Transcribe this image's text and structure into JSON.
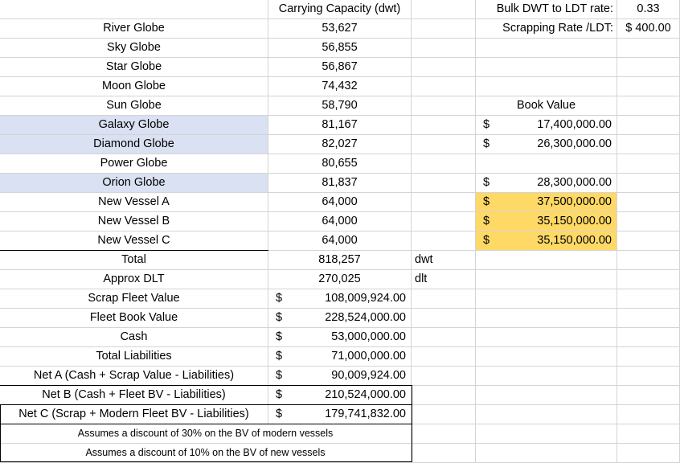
{
  "header": {
    "capacity_label": "Carrying Capacity (dwt)",
    "rate_label": "Bulk DWT to LDT rate:",
    "rate_value": "0.33",
    "scrap_label": "Scrapping Rate /LDT:",
    "scrap_value": "$ 400.00",
    "book_value_label": "Book Value"
  },
  "currency_symbol": "$",
  "vessels": [
    {
      "name": "River Globe",
      "dwt": "53,627",
      "book_value": ""
    },
    {
      "name": "Sky Globe",
      "dwt": "56,855",
      "book_value": ""
    },
    {
      "name": "Star Globe",
      "dwt": "56,867",
      "book_value": ""
    },
    {
      "name": "Moon Globe",
      "dwt": "74,432",
      "book_value": ""
    },
    {
      "name": "Sun Globe",
      "dwt": "58,790",
      "book_value": ""
    },
    {
      "name": "Galaxy Globe",
      "dwt": "81,167",
      "book_value": "17,400,000.00"
    },
    {
      "name": "Diamond Globe",
      "dwt": "82,027",
      "book_value": "26,300,000.00"
    },
    {
      "name": "Power Globe",
      "dwt": "80,655",
      "book_value": ""
    },
    {
      "name": "Orion Globe",
      "dwt": "81,837",
      "book_value": "28,300,000.00"
    },
    {
      "name": "New Vessel A",
      "dwt": "64,000",
      "book_value": "37,500,000.00"
    },
    {
      "name": "New Vessel B",
      "dwt": "64,000",
      "book_value": "35,150,000.00"
    },
    {
      "name": "New Vessel C",
      "dwt": "64,000",
      "book_value": "35,150,000.00"
    }
  ],
  "totals": {
    "total_label": "Total",
    "total_value": "818,257",
    "total_unit": "dwt",
    "dlt_label": "Approx DLT",
    "dlt_value": "270,025",
    "dlt_unit": "dlt"
  },
  "summary": [
    {
      "label": "Scrap Fleet Value",
      "value": "108,009,924.00"
    },
    {
      "label": "Fleet Book Value",
      "value": "228,524,000.00"
    },
    {
      "label": "Cash",
      "value": "53,000,000.00"
    },
    {
      "label": "Total Liabilities",
      "value": "71,000,000.00"
    },
    {
      "label": "Net A (Cash + Scrap Value - Liabilities)",
      "value": "90,009,924.00"
    },
    {
      "label": "Net B (Cash + Fleet BV - Liabilities)",
      "value": "210,524,000.00"
    },
    {
      "label": "Net C (Scrap + Modern Fleet BV - Liabilities)",
      "value": "179,741,832.00"
    }
  ],
  "notes": [
    "Assumes a discount of 30% on the BV of modern vessels",
    "Assumes a discount of 10% on the BV of new vessels"
  ],
  "colors": {
    "highlight_blue": "#d9e1f2",
    "highlight_yellow": "#ffd966",
    "grid": "#d4d4d4"
  }
}
